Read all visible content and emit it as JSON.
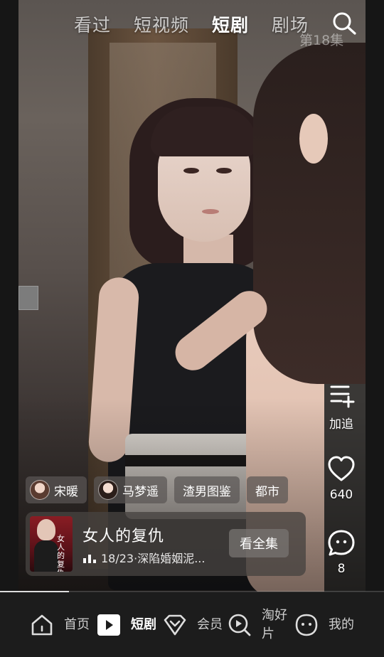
{
  "top_tabs": [
    {
      "label": "看过",
      "active": false
    },
    {
      "label": "短视频",
      "active": false
    },
    {
      "label": "短剧",
      "active": true
    },
    {
      "label": "剧场",
      "active": false
    }
  ],
  "episode_label": "第18集",
  "actions": {
    "add_label": "加追",
    "like_count": "640",
    "comment_count": "8"
  },
  "tags": [
    {
      "label": "宋暖",
      "has_avatar": true
    },
    {
      "label": "马梦遥",
      "has_avatar": true
    },
    {
      "label": "渣男图鉴",
      "has_avatar": false
    },
    {
      "label": "都市",
      "has_avatar": false
    }
  ],
  "drama": {
    "title": "女人的复仇",
    "subtitle": "18/23·深陷婚姻泥...",
    "poster_text": "女人的复仇",
    "button_label": "看全集"
  },
  "progress": 0.18,
  "bottom_nav": [
    {
      "label": "首页",
      "icon": "home-icon",
      "active": false
    },
    {
      "label": "短剧",
      "icon": "play-icon",
      "active": true
    },
    {
      "label": "会员",
      "icon": "vip-diamond-icon",
      "active": false
    },
    {
      "label": "淘好片",
      "icon": "discover-search-icon",
      "active": false
    },
    {
      "label": "我的",
      "icon": "profile-face-icon",
      "active": false
    }
  ],
  "colors": {
    "nav_background": "#1c1c1c",
    "accent": "#ffffff"
  }
}
